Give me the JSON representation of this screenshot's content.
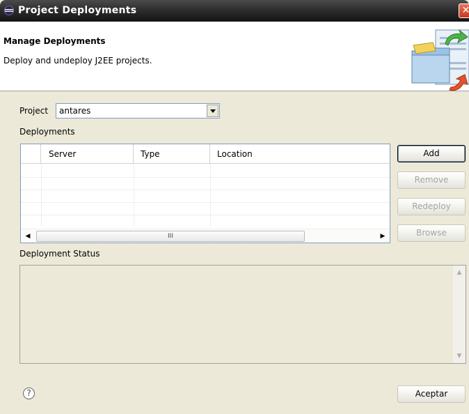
{
  "window": {
    "title": "Project Deployments",
    "close_glyph": "✕"
  },
  "header": {
    "title": "Manage Deployments",
    "description": "Deploy and undeploy J2EE projects."
  },
  "project": {
    "label": "Project",
    "selected": "antares"
  },
  "deployments": {
    "label": "Deployments",
    "columns": [
      "Server",
      "Type",
      "Location"
    ],
    "rows": [],
    "scroll_grip": "III"
  },
  "buttons": {
    "add": "Add",
    "remove": "Remove",
    "redeploy": "Redeploy",
    "browse": "Browse"
  },
  "status": {
    "label": "Deployment Status",
    "text": ""
  },
  "footer": {
    "help_glyph": "?",
    "ok": "Aceptar"
  },
  "icons": {
    "title": "eclipse-icon",
    "banner": "deploy-folders-icon",
    "help": "help-icon"
  }
}
